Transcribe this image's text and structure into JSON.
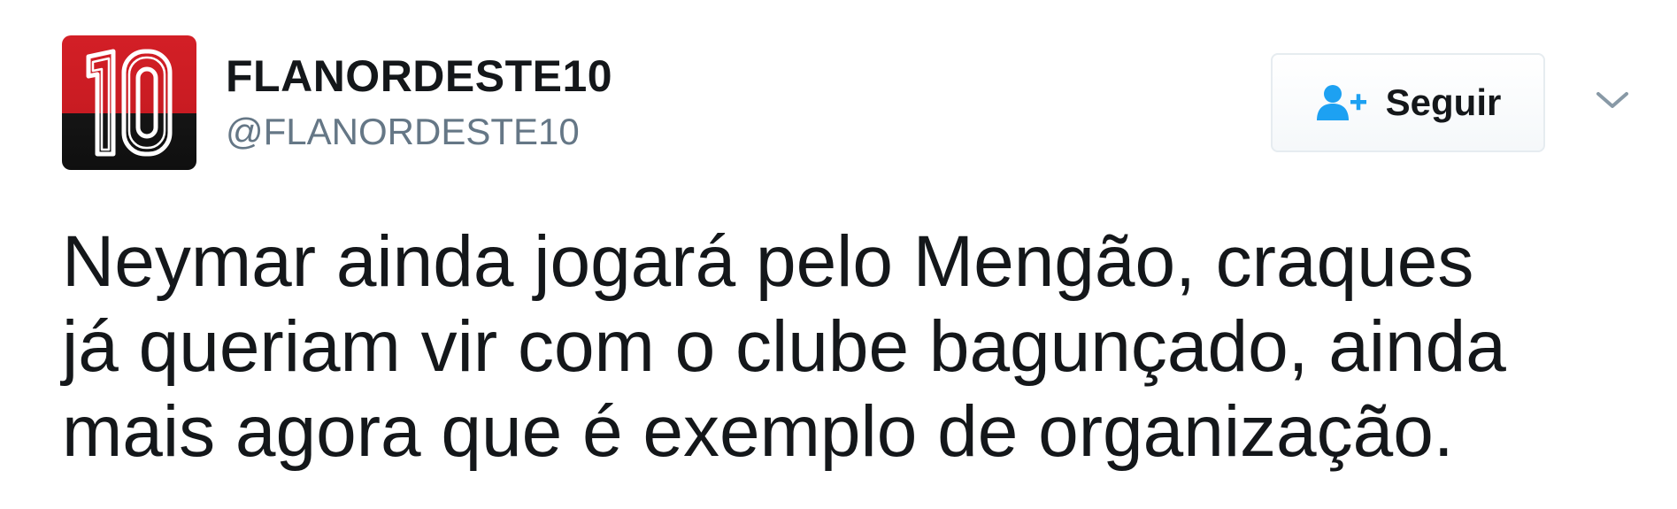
{
  "tweet": {
    "author": {
      "display_name": "FLANORDESTE10",
      "handle": "@FLANORDESTE10",
      "avatar_icon": "jersey-number-10-avatar",
      "avatar_colors": {
        "top": "#d31f26",
        "bottom": "#151515",
        "number": "#ffffff"
      }
    },
    "follow_button": {
      "label": "Seguir",
      "icon": "add-user-icon",
      "icon_color": "#1da1f2"
    },
    "more_menu_icon": "chevron-down-icon",
    "text_lines": [
      "Neymar ainda jogará pelo Mengão, craques",
      "já queriam vir com o clube bagunçado, ainda",
      "mais agora que é exemplo de organização."
    ]
  }
}
